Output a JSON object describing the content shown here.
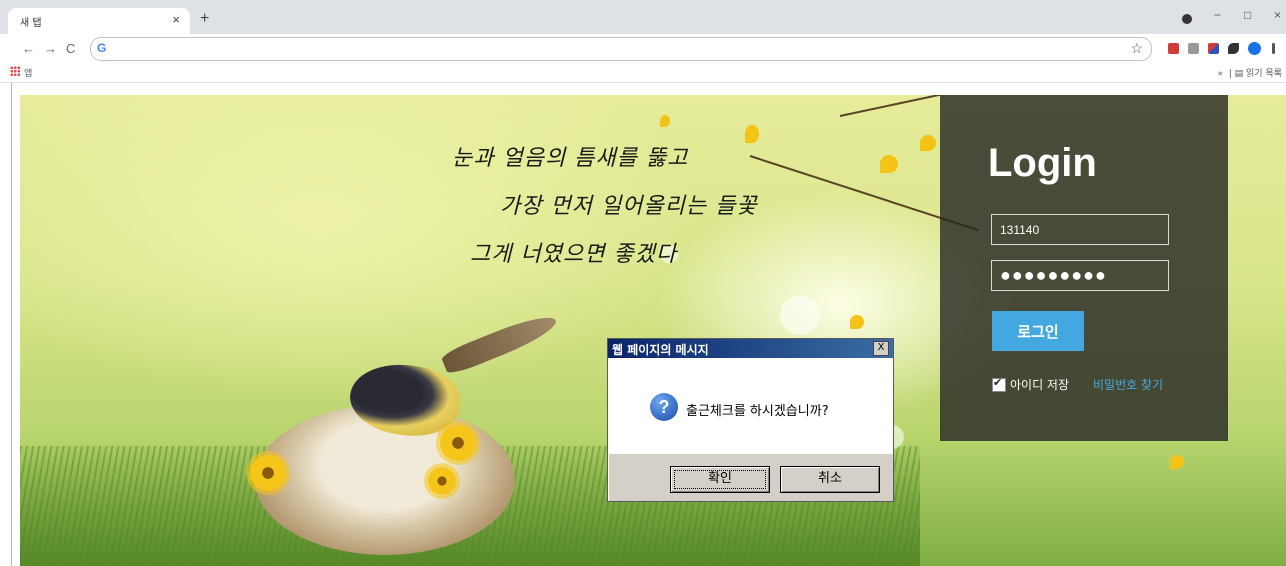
{
  "browser": {
    "tab_title": "새 탭",
    "tab_close": "×",
    "new_tab": "+",
    "win_minimize": "−",
    "win_maximize": "□",
    "win_close": "×",
    "nav_back": "←",
    "nav_forward": "→",
    "nav_reload": "C",
    "omnibox_icon": "G",
    "star": "☆",
    "bookmarks_apps_label": "앱",
    "bookmarks_more": "»",
    "reading_list_label": "읽기 목록"
  },
  "page": {
    "poem": {
      "line1": "눈과 얼음의 틈새를 뚫고",
      "line2": "가장 먼저 일어올리는 들꽃",
      "line3": "그게 너였으면 좋겠다"
    },
    "login": {
      "title": "Login",
      "id_value": "131140",
      "password_mask": "●●●●●●●●●",
      "login_button": "로그인",
      "save_id_label": "아이디 저장",
      "save_id_checked": true,
      "find_password": "비밀번호 찾기"
    }
  },
  "dialog": {
    "title": "웹 페이지의 메시지",
    "close": "X",
    "icon": "?",
    "message": "출근체크를 하시겠습니까?",
    "ok": "확인",
    "cancel": "취소"
  },
  "colors": {
    "login_button": "#44a8e0",
    "find_password_link": "#4aa8e6",
    "dialog_title_bar": "#0a246a"
  }
}
